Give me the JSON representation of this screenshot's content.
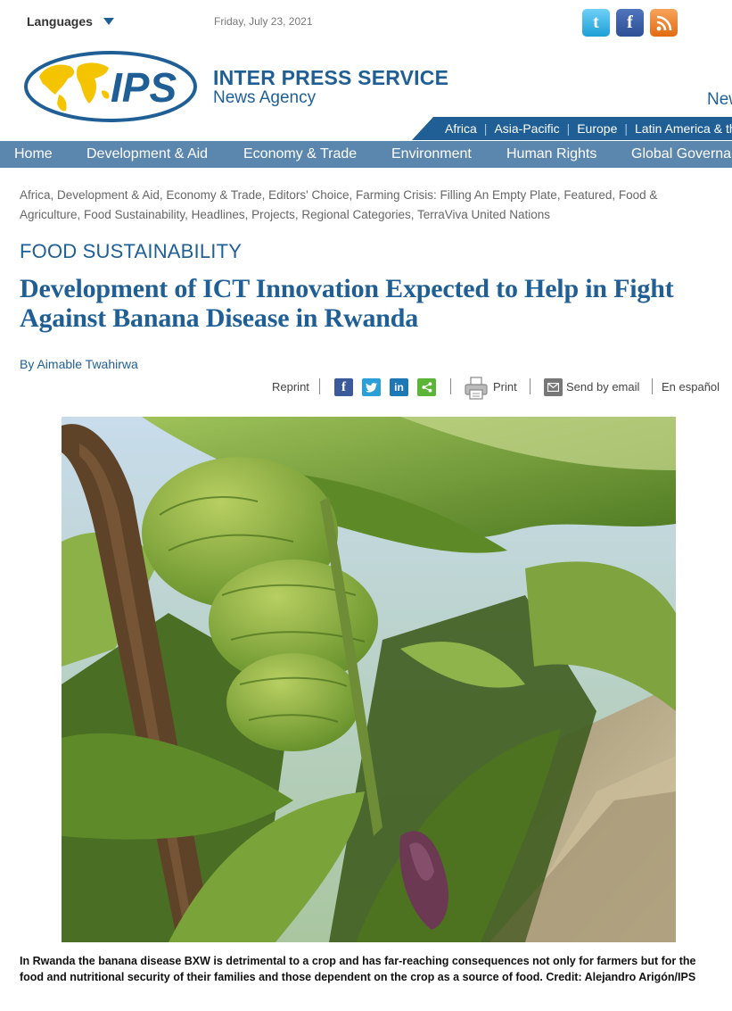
{
  "topbar": {
    "languages_label": "Languages",
    "date": "Friday, July 23, 2021",
    "social_icons": [
      "twitter-icon",
      "facebook-icon",
      "rss-icon"
    ]
  },
  "brand": {
    "logo_text": "IPS",
    "name_line1": "INTER PRESS SERVICE",
    "name_line2": "News Agency",
    "cut_text": "New"
  },
  "regions": [
    "Africa",
    "Asia-Pacific",
    "Europe",
    "Latin America & the"
  ],
  "nav": [
    "Home",
    "Development & Aid",
    "Economy & Trade",
    "Environment",
    "Human Rights",
    "Global Governa"
  ],
  "categories": "Africa, Development & Aid, Economy & Trade, Editors' Choice, Farming Crisis: Filling An Empty Plate, Featured, Food & Agriculture, Food Sustainability, Headlines, Projects, Regional Categories, TerraViva United Nations",
  "article": {
    "section": "FOOD SUSTAINABILITY",
    "headline": "Development of ICT Innovation Expected to Help in Fight Against Banana Disease in Rwanda",
    "byline": "By Aimable Twahirwa",
    "caption": "In Rwanda the banana disease BXW is detrimental to a crop and has far-reaching consequences not only for farmers but for the food and nutritional security of their families and those dependent on the crop as a source of food. Credit: Alejandro Arigón/IPS"
  },
  "tools": {
    "reprint": "Reprint",
    "print": "Print",
    "email": "Send by email",
    "spanish": "En español",
    "share_icons": [
      "facebook-icon",
      "twitter-icon",
      "linkedin-icon",
      "share-icon"
    ]
  },
  "colors": {
    "brand_blue": "#1f5f95",
    "nav_bg": "#5b86ad",
    "logo_yellow": "#f4c400"
  }
}
